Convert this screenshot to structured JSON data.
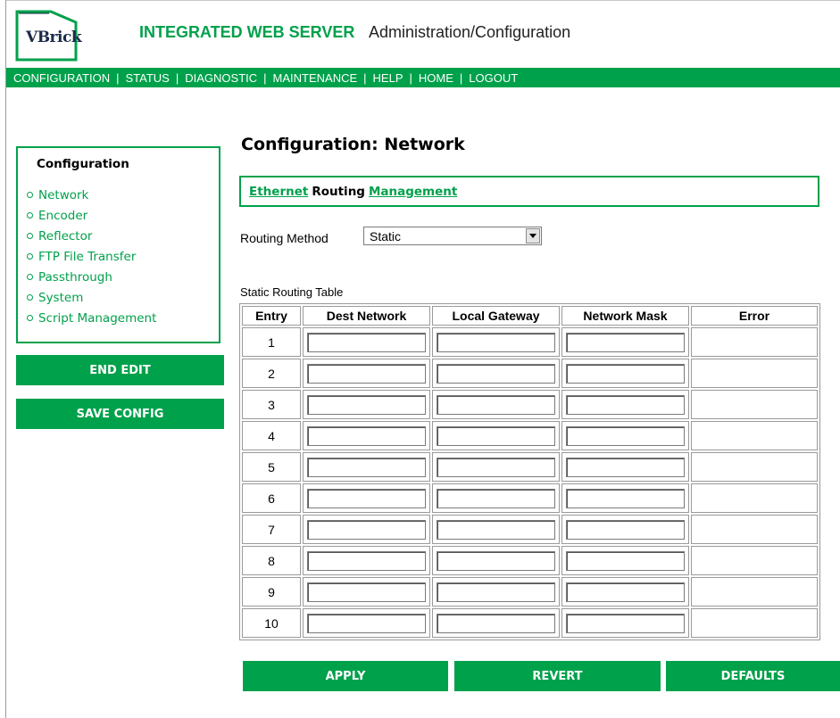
{
  "header": {
    "logo_text": "VBrick",
    "title": "INTEGRATED WEB SERVER",
    "subtitle": "Administration/Configuration"
  },
  "topnav": {
    "items": [
      "CONFIGURATION",
      "STATUS",
      "DIAGNOSTIC",
      "MAINTENANCE",
      "HELP",
      "HOME",
      "LOGOUT"
    ],
    "separator": "|"
  },
  "sidebar": {
    "heading": "Configuration",
    "items": [
      "Network",
      "Encoder",
      "Reflector",
      "FTP File Transfer",
      "Passthrough",
      "System",
      "Script Management"
    ],
    "end_edit_label": "END EDIT",
    "save_config_label": "SAVE CONFIG"
  },
  "main": {
    "page_title": "Configuration: Network",
    "subtabs": {
      "ethernet": "Ethernet",
      "routing": "Routing",
      "management": "Management"
    },
    "routing_method_label": "Routing Method",
    "routing_method_value": "Static",
    "table_caption": "Static Routing Table",
    "columns": [
      "Entry",
      "Dest Network",
      "Local Gateway",
      "Network Mask",
      "Error"
    ],
    "rows": [
      {
        "entry": "1",
        "dest": "",
        "gateway": "",
        "mask": "",
        "error": ""
      },
      {
        "entry": "2",
        "dest": "",
        "gateway": "",
        "mask": "",
        "error": ""
      },
      {
        "entry": "3",
        "dest": "",
        "gateway": "",
        "mask": "",
        "error": ""
      },
      {
        "entry": "4",
        "dest": "",
        "gateway": "",
        "mask": "",
        "error": ""
      },
      {
        "entry": "5",
        "dest": "",
        "gateway": "",
        "mask": "",
        "error": ""
      },
      {
        "entry": "6",
        "dest": "",
        "gateway": "",
        "mask": "",
        "error": ""
      },
      {
        "entry": "7",
        "dest": "",
        "gateway": "",
        "mask": "",
        "error": ""
      },
      {
        "entry": "8",
        "dest": "",
        "gateway": "",
        "mask": "",
        "error": ""
      },
      {
        "entry": "9",
        "dest": "",
        "gateway": "",
        "mask": "",
        "error": ""
      },
      {
        "entry": "10",
        "dest": "",
        "gateway": "",
        "mask": "",
        "error": ""
      }
    ],
    "buttons": {
      "apply": "APPLY",
      "revert": "REVERT",
      "defaults": "DEFAULTS"
    }
  },
  "colors": {
    "accent": "#00a14b",
    "text": "#000000",
    "border": "#9a9a9a"
  }
}
